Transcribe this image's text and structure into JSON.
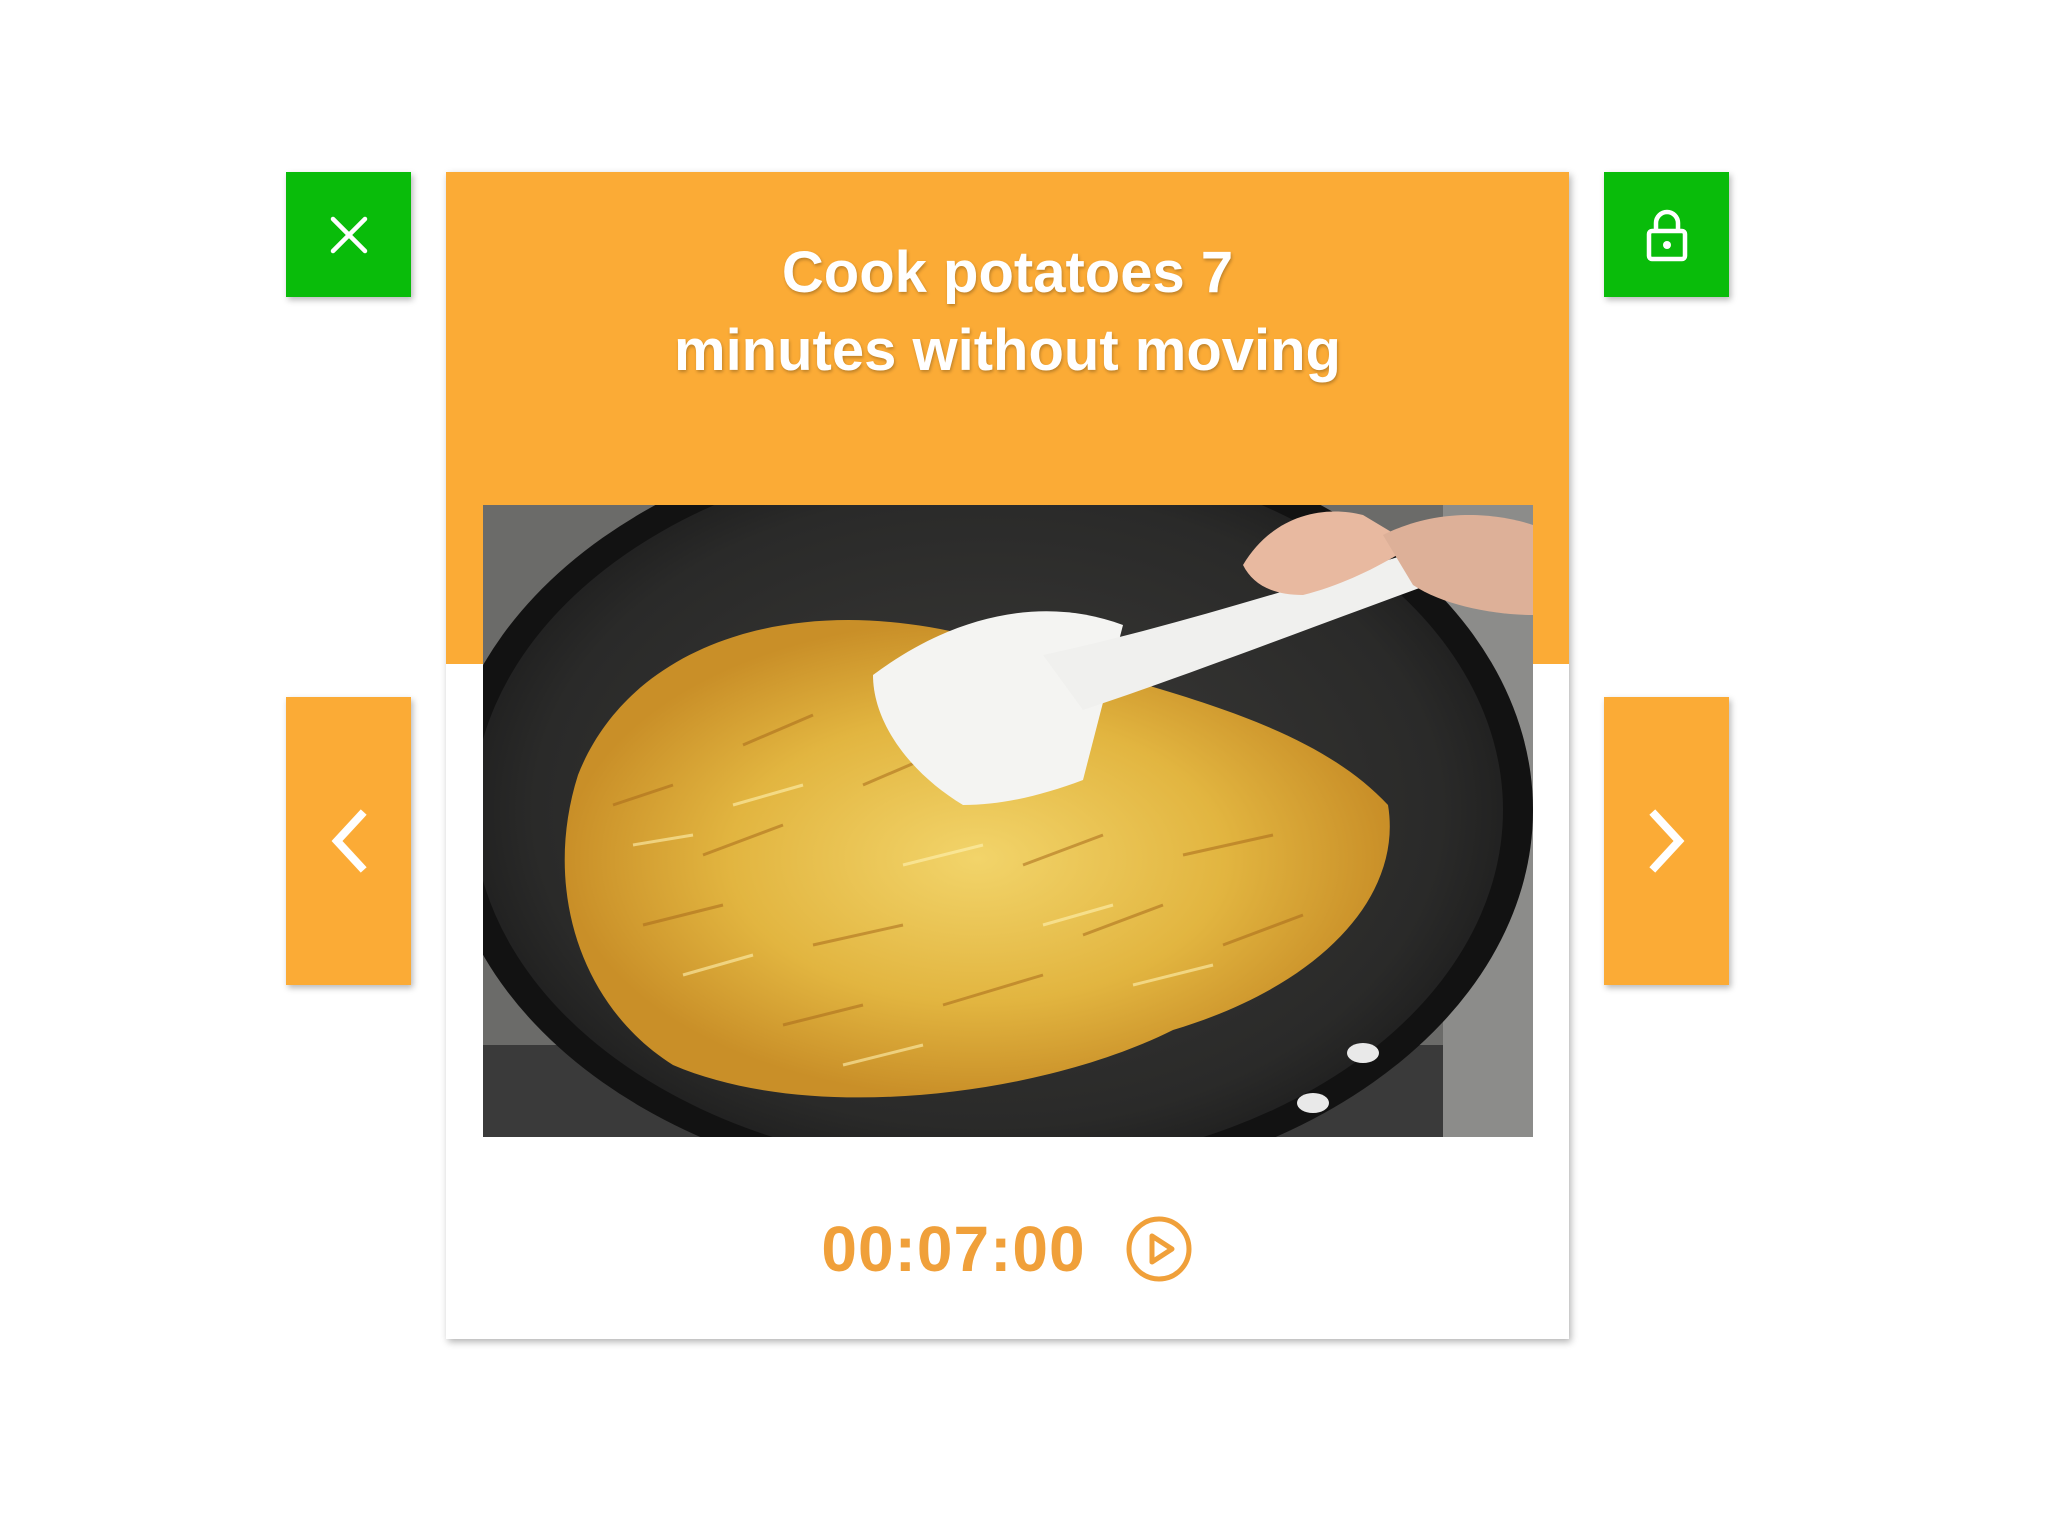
{
  "step": {
    "title": "Cook potatoes 7\nminutes without moving",
    "image_alt": "Shredded potatoes cooking in a dark frying pan with a white spatula"
  },
  "timer": {
    "value": "00:07:00",
    "play_icon": "play-circle-icon"
  },
  "controls": {
    "close_icon": "close-icon",
    "lock_icon": "lock-icon",
    "prev_icon": "chevron-left-icon",
    "next_icon": "chevron-right-icon"
  },
  "colors": {
    "accent_orange": "#fbab36",
    "timer_orange": "#f0a03a",
    "action_green": "#09bc0a"
  }
}
